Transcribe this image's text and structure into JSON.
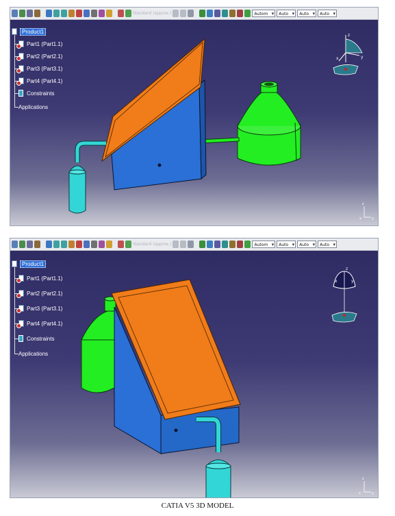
{
  "screenshots": [
    {
      "toolbar": {
        "disabled_field": "Standard (approx.)",
        "combos": [
          "Autom",
          "Auto",
          "Auto",
          "Auto"
        ]
      },
      "tree": {
        "root": "Product1",
        "parts": [
          "Part1 (Part1.1)",
          "Part2 (Part2.1)",
          "Part3 (Part3.1)",
          "Part4 (Part4.1)"
        ],
        "constraints": "Constraints",
        "applications": "Applications"
      },
      "compass_axes": [
        "z",
        "x",
        "y"
      ],
      "bottom_axes": [
        "z",
        "x",
        "y"
      ]
    },
    {
      "toolbar": {
        "disabled_field": "Standard (approx.)",
        "combos": [
          "Autom",
          "Auto",
          "Auto",
          "Auto"
        ]
      },
      "tree": {
        "root": "Product1",
        "parts": [
          "Part1 (Part1.1)",
          "Part2 (Part2.1)",
          "Part3 (Part3.1)",
          "Part4 (Part4.1)"
        ],
        "constraints": "Constraints",
        "applications": "Applications"
      },
      "compass_axes": [
        "z",
        "x",
        "y"
      ],
      "bottom_axes": [
        "z",
        "x",
        "y"
      ]
    }
  ],
  "caption": "CATIA V5 3D MODEL",
  "colors": {
    "solar_panel": "#f07c1a",
    "support_box": "#2a70d6",
    "tank": "#22ee22",
    "pipe": "#33d6d6",
    "viewport_top": "#2f2b63"
  }
}
